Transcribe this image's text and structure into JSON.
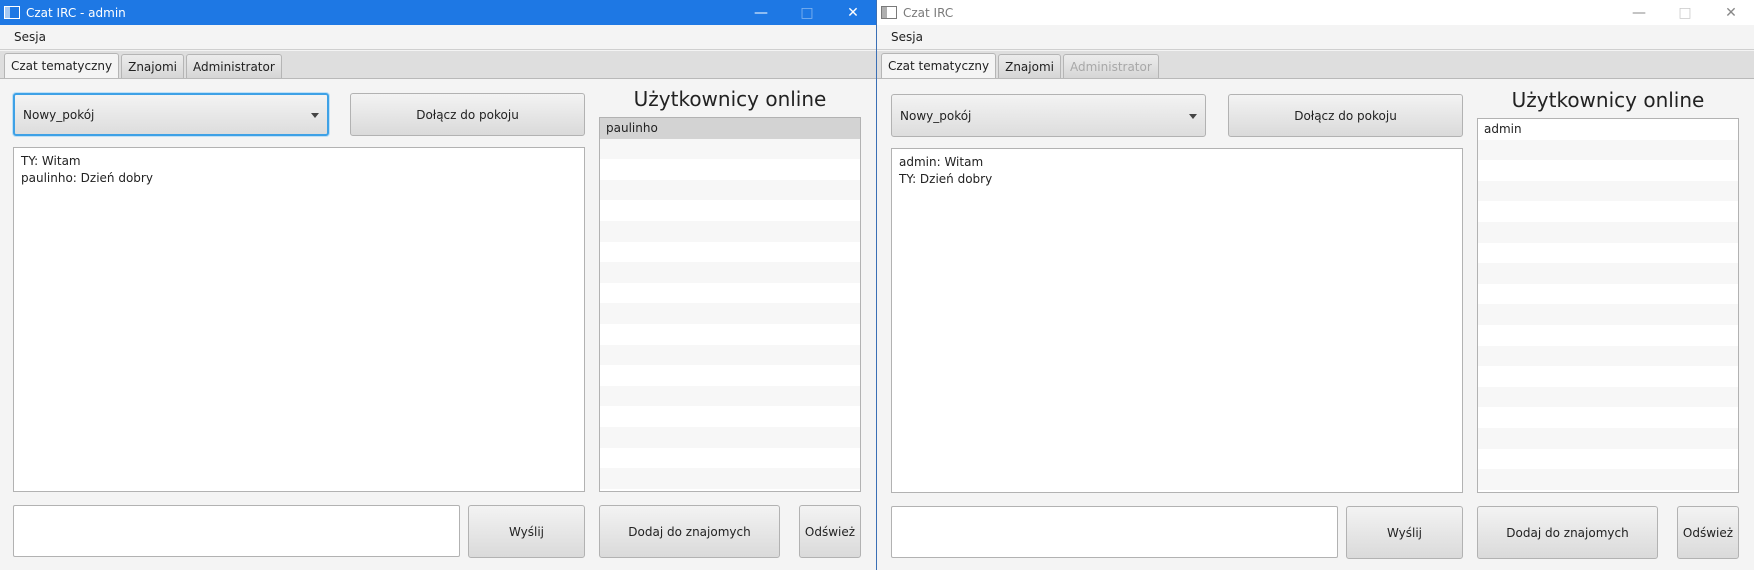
{
  "windows": [
    {
      "title": "Czat IRC - admin",
      "menu": [
        "Sesja"
      ],
      "tabs": [
        {
          "label": "Czat tematyczny",
          "state": "active"
        },
        {
          "label": "Znajomi",
          "state": "normal"
        },
        {
          "label": "Administrator",
          "state": "normal"
        }
      ],
      "room_select": "Nowy_pokój",
      "join_button": "Dołącz do pokoju",
      "online_heading": "Użytkownicy online",
      "messages": [
        "TY: Witam",
        "paulinho: Dzień dobry"
      ],
      "online_users": [
        "paulinho"
      ],
      "message_input": "",
      "send_button": "Wyślij",
      "add_friend_button": "Dodaj do znajomych",
      "refresh_button": "Odśwież"
    },
    {
      "title": "Czat IRC",
      "menu": [
        "Sesja"
      ],
      "tabs": [
        {
          "label": "Czat tematyczny",
          "state": "active"
        },
        {
          "label": "Znajomi",
          "state": "normal"
        },
        {
          "label": "Administrator",
          "state": "disabled"
        }
      ],
      "room_select": "Nowy_pokój",
      "join_button": "Dołącz do pokoju",
      "online_heading": "Użytkownicy online",
      "messages": [
        "admin: Witam",
        "TY: Dzień dobry"
      ],
      "online_users": [
        "admin"
      ],
      "message_input": "",
      "send_button": "Wyślij",
      "add_friend_button": "Dodaj do znajomych",
      "refresh_button": "Odśwież"
    }
  ],
  "colors": {
    "active_titlebar": "#1e78e4",
    "focus_ring": "#3ea1e6",
    "selected_row": "#d3d3d3"
  }
}
